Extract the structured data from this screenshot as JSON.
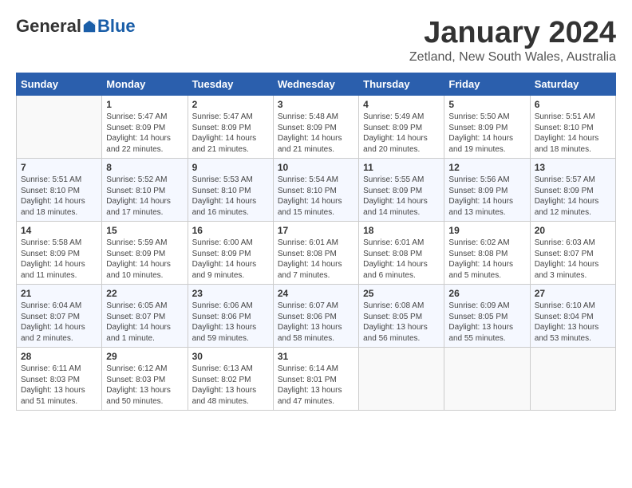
{
  "header": {
    "logo_general": "General",
    "logo_blue": "Blue",
    "month_title": "January 2024",
    "location": "Zetland, New South Wales, Australia"
  },
  "calendar": {
    "days_of_week": [
      "Sunday",
      "Monday",
      "Tuesday",
      "Wednesday",
      "Thursday",
      "Friday",
      "Saturday"
    ],
    "weeks": [
      [
        {
          "day": "",
          "info": ""
        },
        {
          "day": "1",
          "info": "Sunrise: 5:47 AM\nSunset: 8:09 PM\nDaylight: 14 hours\nand 22 minutes."
        },
        {
          "day": "2",
          "info": "Sunrise: 5:47 AM\nSunset: 8:09 PM\nDaylight: 14 hours\nand 21 minutes."
        },
        {
          "day": "3",
          "info": "Sunrise: 5:48 AM\nSunset: 8:09 PM\nDaylight: 14 hours\nand 21 minutes."
        },
        {
          "day": "4",
          "info": "Sunrise: 5:49 AM\nSunset: 8:09 PM\nDaylight: 14 hours\nand 20 minutes."
        },
        {
          "day": "5",
          "info": "Sunrise: 5:50 AM\nSunset: 8:09 PM\nDaylight: 14 hours\nand 19 minutes."
        },
        {
          "day": "6",
          "info": "Sunrise: 5:51 AM\nSunset: 8:10 PM\nDaylight: 14 hours\nand 18 minutes."
        }
      ],
      [
        {
          "day": "7",
          "info": "Sunrise: 5:51 AM\nSunset: 8:10 PM\nDaylight: 14 hours\nand 18 minutes."
        },
        {
          "day": "8",
          "info": "Sunrise: 5:52 AM\nSunset: 8:10 PM\nDaylight: 14 hours\nand 17 minutes."
        },
        {
          "day": "9",
          "info": "Sunrise: 5:53 AM\nSunset: 8:10 PM\nDaylight: 14 hours\nand 16 minutes."
        },
        {
          "day": "10",
          "info": "Sunrise: 5:54 AM\nSunset: 8:10 PM\nDaylight: 14 hours\nand 15 minutes."
        },
        {
          "day": "11",
          "info": "Sunrise: 5:55 AM\nSunset: 8:09 PM\nDaylight: 14 hours\nand 14 minutes."
        },
        {
          "day": "12",
          "info": "Sunrise: 5:56 AM\nSunset: 8:09 PM\nDaylight: 14 hours\nand 13 minutes."
        },
        {
          "day": "13",
          "info": "Sunrise: 5:57 AM\nSunset: 8:09 PM\nDaylight: 14 hours\nand 12 minutes."
        }
      ],
      [
        {
          "day": "14",
          "info": "Sunrise: 5:58 AM\nSunset: 8:09 PM\nDaylight: 14 hours\nand 11 minutes."
        },
        {
          "day": "15",
          "info": "Sunrise: 5:59 AM\nSunset: 8:09 PM\nDaylight: 14 hours\nand 10 minutes."
        },
        {
          "day": "16",
          "info": "Sunrise: 6:00 AM\nSunset: 8:09 PM\nDaylight: 14 hours\nand 9 minutes."
        },
        {
          "day": "17",
          "info": "Sunrise: 6:01 AM\nSunset: 8:08 PM\nDaylight: 14 hours\nand 7 minutes."
        },
        {
          "day": "18",
          "info": "Sunrise: 6:01 AM\nSunset: 8:08 PM\nDaylight: 14 hours\nand 6 minutes."
        },
        {
          "day": "19",
          "info": "Sunrise: 6:02 AM\nSunset: 8:08 PM\nDaylight: 14 hours\nand 5 minutes."
        },
        {
          "day": "20",
          "info": "Sunrise: 6:03 AM\nSunset: 8:07 PM\nDaylight: 14 hours\nand 3 minutes."
        }
      ],
      [
        {
          "day": "21",
          "info": "Sunrise: 6:04 AM\nSunset: 8:07 PM\nDaylight: 14 hours\nand 2 minutes."
        },
        {
          "day": "22",
          "info": "Sunrise: 6:05 AM\nSunset: 8:07 PM\nDaylight: 14 hours\nand 1 minute."
        },
        {
          "day": "23",
          "info": "Sunrise: 6:06 AM\nSunset: 8:06 PM\nDaylight: 13 hours\nand 59 minutes."
        },
        {
          "day": "24",
          "info": "Sunrise: 6:07 AM\nSunset: 8:06 PM\nDaylight: 13 hours\nand 58 minutes."
        },
        {
          "day": "25",
          "info": "Sunrise: 6:08 AM\nSunset: 8:05 PM\nDaylight: 13 hours\nand 56 minutes."
        },
        {
          "day": "26",
          "info": "Sunrise: 6:09 AM\nSunset: 8:05 PM\nDaylight: 13 hours\nand 55 minutes."
        },
        {
          "day": "27",
          "info": "Sunrise: 6:10 AM\nSunset: 8:04 PM\nDaylight: 13 hours\nand 53 minutes."
        }
      ],
      [
        {
          "day": "28",
          "info": "Sunrise: 6:11 AM\nSunset: 8:03 PM\nDaylight: 13 hours\nand 51 minutes."
        },
        {
          "day": "29",
          "info": "Sunrise: 6:12 AM\nSunset: 8:03 PM\nDaylight: 13 hours\nand 50 minutes."
        },
        {
          "day": "30",
          "info": "Sunrise: 6:13 AM\nSunset: 8:02 PM\nDaylight: 13 hours\nand 48 minutes."
        },
        {
          "day": "31",
          "info": "Sunrise: 6:14 AM\nSunset: 8:01 PM\nDaylight: 13 hours\nand 47 minutes."
        },
        {
          "day": "",
          "info": ""
        },
        {
          "day": "",
          "info": ""
        },
        {
          "day": "",
          "info": ""
        }
      ]
    ]
  }
}
